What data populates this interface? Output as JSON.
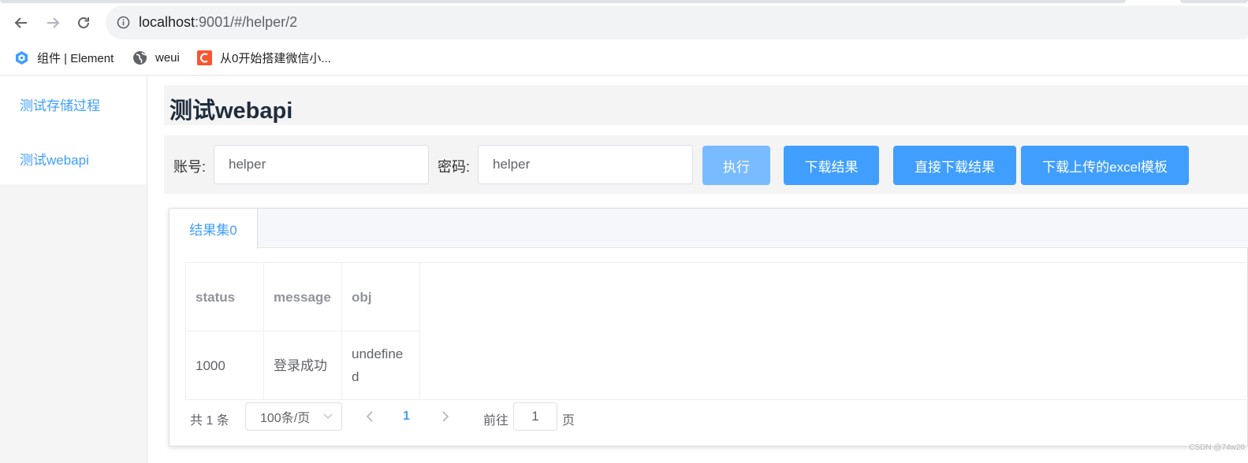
{
  "browser": {
    "url_host": "localhost",
    "url_rest": ":9001/#/helper/2",
    "bookmarks": [
      {
        "label": "组件 | Element",
        "icon": "element-logo-icon"
      },
      {
        "label": "weui",
        "icon": "globe-icon"
      },
      {
        "label": "从0开始搭建微信小...",
        "icon": "csdn-logo-icon"
      }
    ]
  },
  "sidebar": {
    "items": [
      {
        "label": "测试存储过程"
      },
      {
        "label": "测试webapi"
      }
    ]
  },
  "main": {
    "title": "测试webapi",
    "form": {
      "account_label": "账号:",
      "account_value": "helper",
      "password_label": "密码:",
      "password_value": "helper",
      "buttons": {
        "execute": "执行",
        "download": "下载结果",
        "direct_download": "直接下载结果",
        "download_template": "下载上传的excel模板"
      }
    },
    "tabs": [
      {
        "label": "结果集0",
        "active": true
      }
    ],
    "table": {
      "columns": [
        "status",
        "message",
        "obj"
      ],
      "rows": [
        [
          "1000",
          "登录成功",
          "undefined"
        ]
      ]
    },
    "pagination": {
      "total": "共 1 条",
      "page_size": "100条/页",
      "current_page": "1",
      "goto_prefix": "前往",
      "goto_value": "1",
      "goto_suffix": "页"
    }
  },
  "watermark": "CSDN @74w20",
  "colors": {
    "primary": "#409eff",
    "primary_disabled": "#79bbff",
    "header_text": "#909399",
    "body_text": "#606266"
  }
}
